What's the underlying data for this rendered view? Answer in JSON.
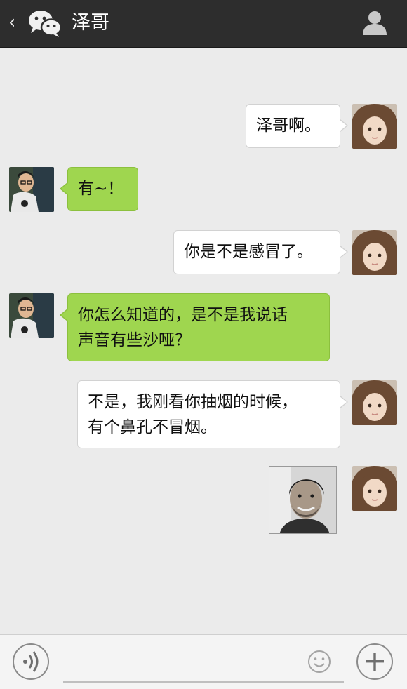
{
  "header": {
    "title": "泽哥",
    "back_icon": "chevron-left-icon",
    "logo_icon": "wechat-logo-icon",
    "profile_icon": "person-icon"
  },
  "messages": [
    {
      "side": "out",
      "lines": [
        "泽哥啊。"
      ]
    },
    {
      "side": "in",
      "lines": [
        "有~！"
      ]
    },
    {
      "side": "out",
      "lines": [
        "你是不是感冒了。"
      ]
    },
    {
      "side": "in",
      "lines": [
        "你怎么知道的，是不是我说话",
        "声音有些沙哑？"
      ]
    },
    {
      "side": "out",
      "lines": [
        "不是，我刚看你抽烟的时候，",
        "有个鼻孔不冒烟。"
      ]
    },
    {
      "side": "out",
      "type": "image",
      "image": "smiling-man-photo"
    }
  ],
  "toolbar": {
    "voice_icon": "voice-icon",
    "input_value": "",
    "emoji_icon": "smiley-icon",
    "plus_icon": "plus-icon"
  },
  "colors": {
    "header_bg": "#2d2d2d",
    "chat_bg": "#ebebeb",
    "incoming_bubble": "#9fd64f",
    "outgoing_bubble": "#ffffff"
  }
}
